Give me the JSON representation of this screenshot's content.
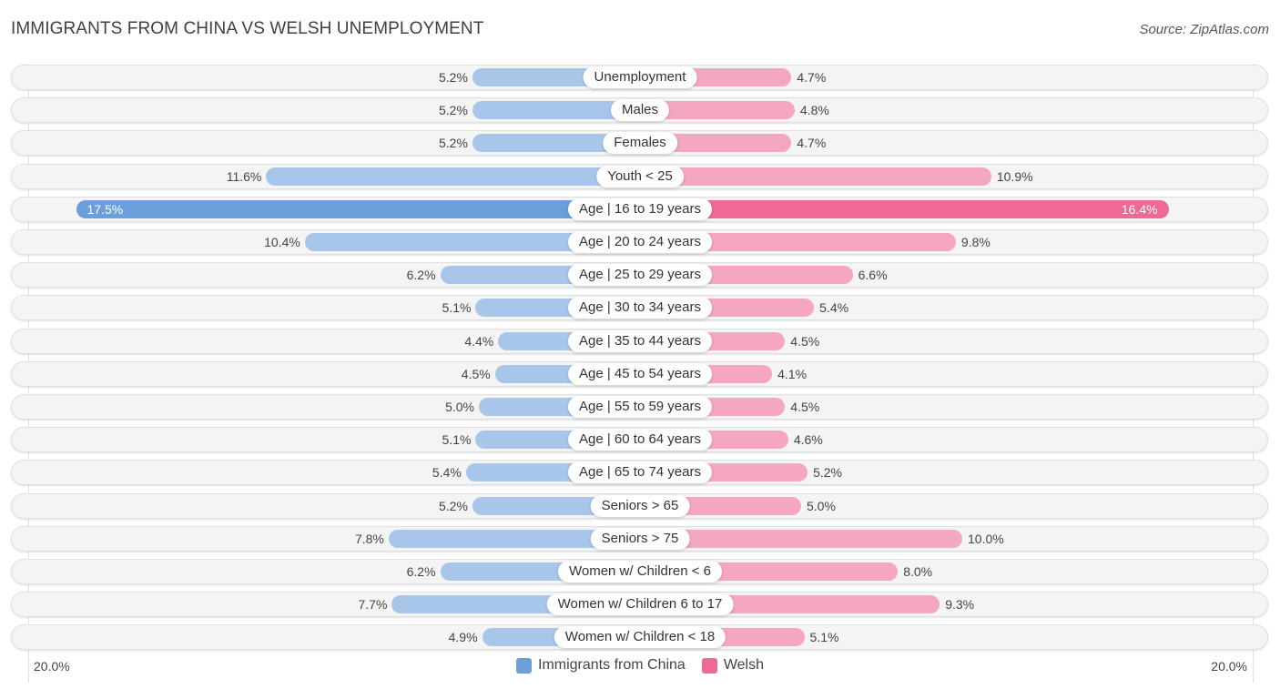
{
  "header": {
    "title": "IMMIGRANTS FROM CHINA VS WELSH UNEMPLOYMENT",
    "source": "Source: ZipAtlas.com"
  },
  "colors": {
    "left": "#a7c6ea",
    "left_highlight": "#6a9fdc",
    "right": "#f5a6c0",
    "right_highlight": "#f06894"
  },
  "chart_data": {
    "type": "bar",
    "orientation": "horizontal-diverging",
    "title": "IMMIGRANTS FROM CHINA VS WELSH UNEMPLOYMENT",
    "xlim": [
      -20,
      20
    ],
    "axis_tick_left": "20.0%",
    "axis_tick_right": "20.0%",
    "legend_position": "bottom-center",
    "categories": [
      "Unemployment",
      "Males",
      "Females",
      "Youth < 25",
      "Age | 16 to 19 years",
      "Age | 20 to 24 years",
      "Age | 25 to 29 years",
      "Age | 30 to 34 years",
      "Age | 35 to 44 years",
      "Age | 45 to 54 years",
      "Age | 55 to 59 years",
      "Age | 60 to 64 years",
      "Age | 65 to 74 years",
      "Seniors > 65",
      "Seniors > 75",
      "Women w/ Children < 6",
      "Women w/ Children 6 to 17",
      "Women w/ Children < 18"
    ],
    "series": [
      {
        "name": "Immigrants from China",
        "side": "left",
        "values": [
          5.2,
          5.2,
          5.2,
          11.6,
          17.5,
          10.4,
          6.2,
          5.1,
          4.4,
          4.5,
          5.0,
          5.1,
          5.4,
          5.2,
          7.8,
          6.2,
          7.7,
          4.9
        ],
        "labels": [
          "5.2%",
          "5.2%",
          "5.2%",
          "11.6%",
          "17.5%",
          "10.4%",
          "6.2%",
          "5.1%",
          "4.4%",
          "4.5%",
          "5.0%",
          "5.1%",
          "5.4%",
          "5.2%",
          "7.8%",
          "6.2%",
          "7.7%",
          "4.9%"
        ]
      },
      {
        "name": "Welsh",
        "side": "right",
        "values": [
          4.7,
          4.8,
          4.7,
          10.9,
          16.4,
          9.8,
          6.6,
          5.4,
          4.5,
          4.1,
          4.5,
          4.6,
          5.2,
          5.0,
          10.0,
          8.0,
          9.3,
          5.1
        ],
        "labels": [
          "4.7%",
          "4.8%",
          "4.7%",
          "10.9%",
          "16.4%",
          "9.8%",
          "6.6%",
          "5.4%",
          "4.5%",
          "4.1%",
          "4.5%",
          "4.6%",
          "5.2%",
          "5.0%",
          "10.0%",
          "8.0%",
          "9.3%",
          "5.1%"
        ]
      }
    ],
    "highlighted_category": "Age | 16 to 19 years"
  },
  "legend": [
    {
      "name": "Immigrants from China",
      "color": "#6a9fdc"
    },
    {
      "name": "Welsh",
      "color": "#f06894"
    }
  ]
}
